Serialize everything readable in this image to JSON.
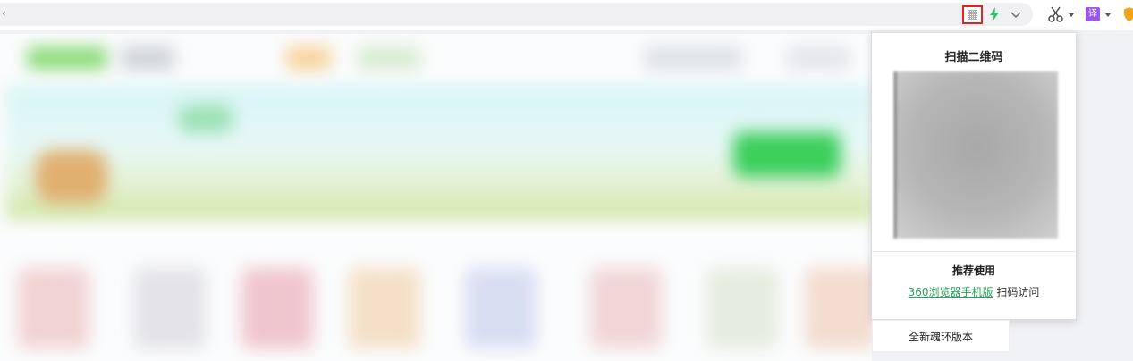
{
  "toolbar": {
    "url_text": "‹",
    "icons": {
      "qr": "qr-code-icon",
      "bolt": "lightning-icon",
      "dropdown": "chevron-down-icon",
      "cut": "scissors-icon",
      "translate": "translate-icon",
      "shield": "shield-icon"
    },
    "translate_glyph": "译",
    "colors": {
      "highlight_border": "#e02424",
      "bolt": "#2bc36b",
      "translate": "#9b59e6",
      "shield": "#f3a316"
    }
  },
  "popup": {
    "title": "扫描二维码",
    "recommend_title": "推荐使用",
    "app_link": "360浏览器手机版",
    "scan_text": " 扫码访问"
  },
  "below_item": "全新魂环版本"
}
